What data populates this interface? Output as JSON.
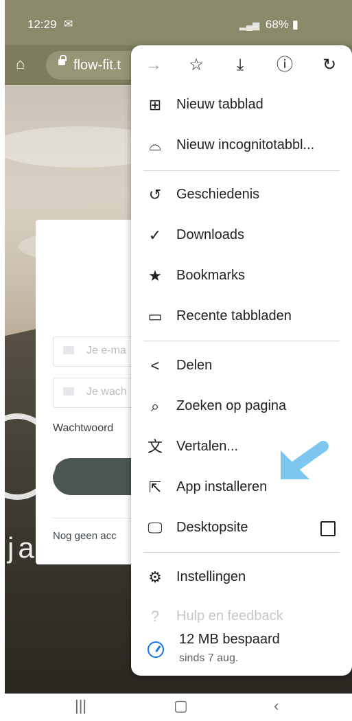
{
  "status": {
    "time": "12:29",
    "battery": "68%",
    "icons": [
      "mail-icon",
      "wifi-icon",
      "signal-icon",
      "battery-icon"
    ]
  },
  "browser": {
    "url": "flow-fit.t"
  },
  "page": {
    "email_placeholder": "Je e-ma",
    "password_placeholder": "Je wach",
    "forgot": "Wachtwoord",
    "no_account": "Nog geen acc",
    "big_text": "ja"
  },
  "menu": {
    "top_icons": [
      "forward-icon",
      "bookmark-star-icon",
      "download-icon",
      "info-icon",
      "reload-icon"
    ],
    "items": [
      {
        "label": "Nieuw tabblad",
        "icon": "new-tab-icon"
      },
      {
        "label": "Nieuw incognitotabbl...",
        "icon": "incognito-icon"
      },
      {
        "label": "Geschiedenis",
        "icon": "history-icon"
      },
      {
        "label": "Downloads",
        "icon": "downloads-icon"
      },
      {
        "label": "Bookmarks",
        "icon": "star-icon"
      },
      {
        "label": "Recente tabbladen",
        "icon": "devices-icon"
      },
      {
        "label": "Delen",
        "icon": "share-icon"
      },
      {
        "label": "Zoeken op pagina",
        "icon": "find-in-page-icon"
      },
      {
        "label": "Vertalen...",
        "icon": "translate-icon"
      },
      {
        "label": "App installeren",
        "icon": "install-app-icon"
      },
      {
        "label": "Desktopsite",
        "icon": "desktop-icon"
      },
      {
        "label": "Instellingen",
        "icon": "settings-icon"
      },
      {
        "label": "Hulp en feedback",
        "icon": "help-icon"
      }
    ],
    "savings": {
      "title": "12 MB bespaard",
      "subtitle": "sinds 7 aug."
    }
  },
  "colors": {
    "accent": "#1a73e8",
    "annotation": "#7cc6ef"
  }
}
